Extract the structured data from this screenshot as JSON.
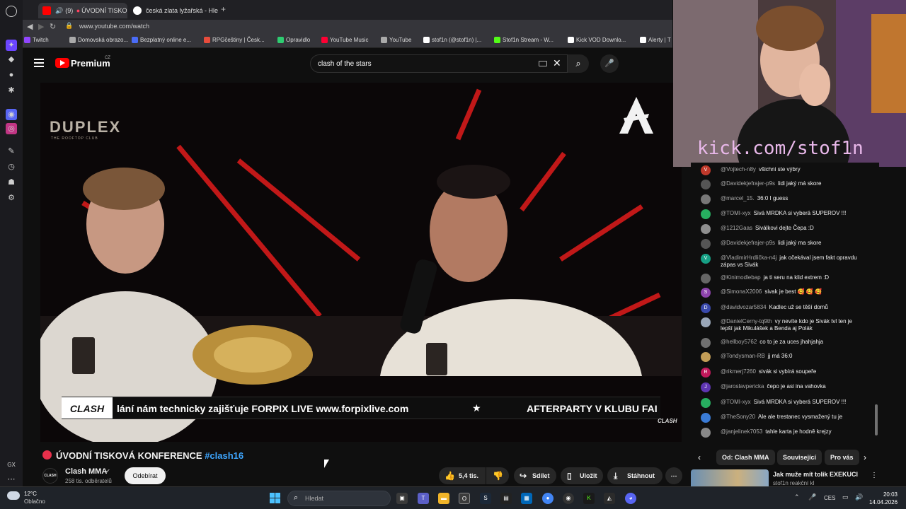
{
  "browser": {
    "tabs": [
      {
        "label": "(9)",
        "label2": "ÚVODNÍ TISKO",
        "active": true
      },
      {
        "label": "česká zlata lyžařská - Hled",
        "active": false
      }
    ],
    "url": "www.youtube.com/watch",
    "bookmarks": [
      {
        "label": "Twitch",
        "color": "#9146ff"
      },
      {
        "label": "Domovská obrazo...",
        "color": "#aaaaaa"
      },
      {
        "label": "Bezplatný online e...",
        "color": "#4a6cf7"
      },
      {
        "label": "RPGčeštiny | Česk...",
        "color": "#e74c3c"
      },
      {
        "label": "Opravidlo",
        "color": "#2ecc71"
      },
      {
        "label": "YouTube Music",
        "color": "#ff0033"
      },
      {
        "label": "YouTube",
        "color": "#aaaaaa"
      },
      {
        "label": "stof1n (@stof1n) |...",
        "color": "#ffffff"
      },
      {
        "label": "Stof1n Stream - W...",
        "color": "#53fc18"
      },
      {
        "label": "Kick VOD Downlo...",
        "color": "#ffffff"
      },
      {
        "label": "Alerty | T",
        "color": "#ffffff"
      }
    ],
    "sidebar_label": "GX"
  },
  "youtube": {
    "brand": "Premium",
    "country": "CZ",
    "search_value": "clash of the stars",
    "video": {
      "overlay_logo": "DUPLEX",
      "overlay_logo_sub": "THE ROOFTOP CLUB",
      "ticker_logo": "CLASH",
      "ticker_text": "lání nám technicky zajišťuje FORPIX LIVE www.forpixlive.com",
      "ticker_star": "★",
      "ticker_text2": "AFTERPARTY V KLUBU FAI",
      "watermark": "CLASH"
    },
    "title": "ÚVODNÍ TISKOVÁ KONFERENCE",
    "hashtag": "#clash16",
    "channel": {
      "avatar_text": "CLASH",
      "name": "Clash MMA",
      "verified": "✔",
      "subscribers": "258 tis. odběratelů",
      "subscribe_label": "Odebírat"
    },
    "actions": {
      "likes": "5,4 tis.",
      "share": "Sdílet",
      "save": "Uložit",
      "download": "Stáhnout"
    }
  },
  "stream": {
    "kick_url": "kick.com/stof1n"
  },
  "chat": [
    {
      "initial": "V",
      "color": "#c0392b",
      "user": "@Vojtech-n8y",
      "text": "všichni ste výbry"
    },
    {
      "initial": "",
      "color": "#555555",
      "user": "@Davidekjefrajer-p9s",
      "text": "lidi jaký má skore"
    },
    {
      "initial": "",
      "color": "#777777",
      "user": "@marcel_15.",
      "text": "36:0 I guess"
    },
    {
      "initial": "",
      "color": "#27ae60",
      "user": "@TOMI-xyx",
      "text": "Sivá MRDKA si vyberá SUPEROV !!!"
    },
    {
      "initial": "",
      "color": "#8e8e8e",
      "user": "@1212Gaas",
      "text": "Siválkovi dejte Čepa :D"
    },
    {
      "initial": "",
      "color": "#555555",
      "user": "@Davidekjefrajer-p9s",
      "text": "lidi jaký ma skore"
    },
    {
      "initial": "V",
      "color": "#16a085",
      "user": "@VladimirHrdlička-n4j",
      "text": "jak očekával jsem fakt opravdu zápas vs Sivák"
    },
    {
      "initial": "",
      "color": "#666666",
      "user": "@Kinimodlebap",
      "text": "ja ti seru na klid extrem :D"
    },
    {
      "initial": "S",
      "color": "#8e44ad",
      "user": "@SimonaX2006",
      "text": "sivak je best 🥰 🥰 🥰"
    },
    {
      "initial": "D",
      "color": "#3949ab",
      "user": "@davidvozar5834",
      "text": "Kadlec už se těší domů"
    },
    {
      "initial": "",
      "color": "#9aa7b8",
      "user": "@DanielCerny-tq9th",
      "text": "vy nevíte kdo je Sivák tvl ten je lepší jak Mikulášek a Benda aj Polák"
    },
    {
      "initial": "",
      "color": "#707070",
      "user": "@hellboy5762",
      "text": "co to je za uces jhahjahja"
    },
    {
      "initial": "",
      "color": "#c29d56",
      "user": "@Tondysman-RB",
      "text": "jj má 36:0"
    },
    {
      "initial": "R",
      "color": "#c2185b",
      "user": "@rikmerj7260",
      "text": "sivák si vybírá soupeře"
    },
    {
      "initial": "J",
      "color": "#5e35b1",
      "user": "@jaroslavpericka",
      "text": "čepo je asi ina vahovka"
    },
    {
      "initial": "",
      "color": "#27ae60",
      "user": "@TOMI-xyx",
      "text": "Sivá MRDKA si vyberá SUPEROV !!!"
    },
    {
      "initial": "",
      "color": "#3a7bd5",
      "user": "@TheSony20",
      "text": "Ale ale trestanec vysmažený tu je"
    },
    {
      "initial": "",
      "color": "#888888",
      "user": "@janjelinek7053",
      "text": "tahle karta je hodně krejzy"
    }
  ],
  "related": {
    "chips": [
      "Od: Clash MMA",
      "Související",
      "Pro vás"
    ],
    "rec_title": "Jak muže mít tolik EXEKUCI",
    "rec_channel": "stof1n reakční kl"
  },
  "taskbar": {
    "temp": "12°C",
    "weather": "Oblačno",
    "search_placeholder": "Hledat",
    "lang": "CES",
    "time": "20:03",
    "date": "14.04.2026"
  }
}
